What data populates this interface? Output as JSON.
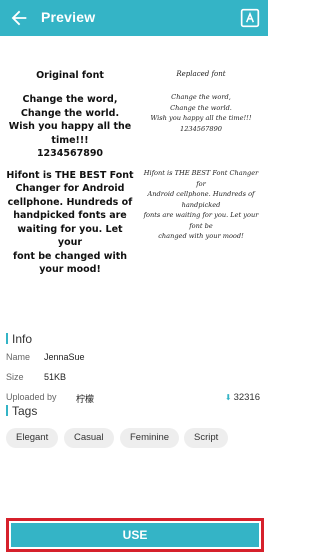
{
  "app_bar": {
    "title": "Preview",
    "back_icon": "arrow-back-icon",
    "action_icon": "font-translate-icon",
    "color": "#34b4c6"
  },
  "preview": {
    "original_heading": "Original font",
    "original_para1": "Change the word,\nChange the world.\nWish you happy all the\ntime!!!\n1234567890",
    "original_para2": "Hifont is THE BEST Font\nChanger for Android\ncellphone. Hundreds of\nhandpicked fonts are\nwaiting for you. Let your\nfont be changed with\nyour mood!",
    "replaced_heading": "Replaced font",
    "replaced_para1": "Change the word,\nChange the world.\nWish you happy all the time!!!\n1234567890",
    "replaced_para2": "Hifont is THE BEST Font Changer for\nAndroid cellphone. Hundreds of handpicked\nfonts are waiting for you. Let your font be\nchanged with your mood!"
  },
  "info": {
    "section_title": "Info",
    "name_label": "Name",
    "name_value": "JennaSue",
    "size_label": "Size",
    "size_value": "51KB",
    "uploader_label": "Uploaded by",
    "uploader_value": "柠檬",
    "downloads_icon": "download-icon",
    "downloads": "32316"
  },
  "tags": {
    "section_title": "Tags",
    "items": [
      "Elegant",
      "Casual",
      "Feminine",
      "Script"
    ]
  },
  "use_button": {
    "label": "USE",
    "color": "#34b4c6",
    "highlight_color": "#d6202b"
  }
}
